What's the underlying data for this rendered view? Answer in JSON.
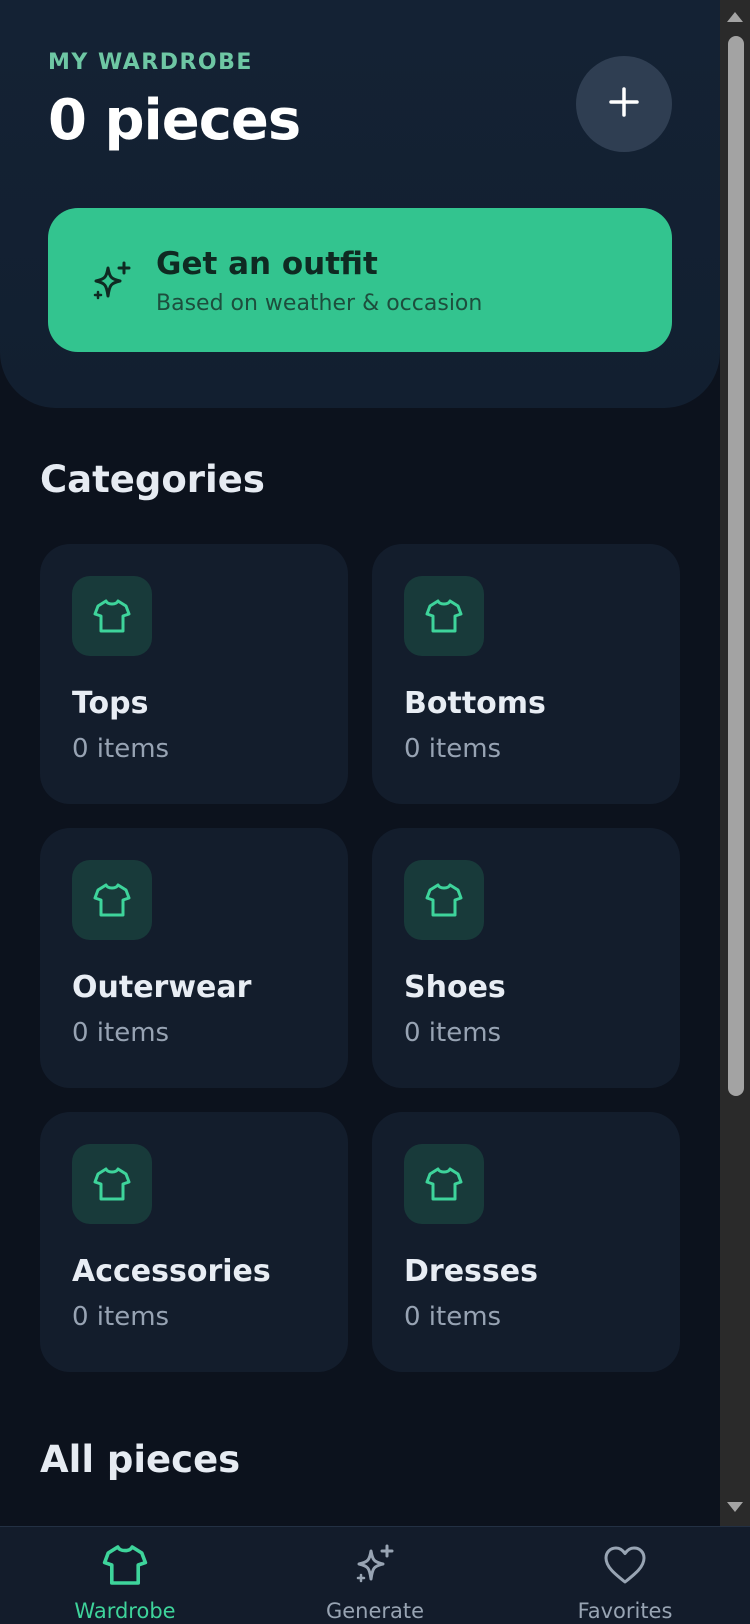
{
  "header": {
    "eyebrow": "MY WARDROBE",
    "title": "0 pieces",
    "add_icon": "plus-icon"
  },
  "cta": {
    "icon": "sparkles-icon",
    "title": "Get an outfit",
    "subtitle": "Based on weather & occasion"
  },
  "categories": {
    "title": "Categories",
    "items": [
      {
        "name": "Tops",
        "count": "0 items",
        "icon": "shirt-icon"
      },
      {
        "name": "Bottoms",
        "count": "0 items",
        "icon": "shirt-icon"
      },
      {
        "name": "Outerwear",
        "count": "0 items",
        "icon": "shirt-icon"
      },
      {
        "name": "Shoes",
        "count": "0 items",
        "icon": "shirt-icon"
      },
      {
        "name": "Accessories",
        "count": "0 items",
        "icon": "shirt-icon"
      },
      {
        "name": "Dresses",
        "count": "0 items",
        "icon": "shirt-icon"
      }
    ]
  },
  "all_pieces": {
    "title": "All pieces"
  },
  "nav": {
    "items": [
      {
        "label": "Wardrobe",
        "icon": "shirt-icon",
        "active": true
      },
      {
        "label": "Generate",
        "icon": "sparkles-icon",
        "active": false
      },
      {
        "label": "Favorites",
        "icon": "heart-icon",
        "active": false
      }
    ]
  },
  "colors": {
    "accent": "#33c48f",
    "background": "#0c121d",
    "card": "#131d2c",
    "inactive": "#98a4b3"
  }
}
